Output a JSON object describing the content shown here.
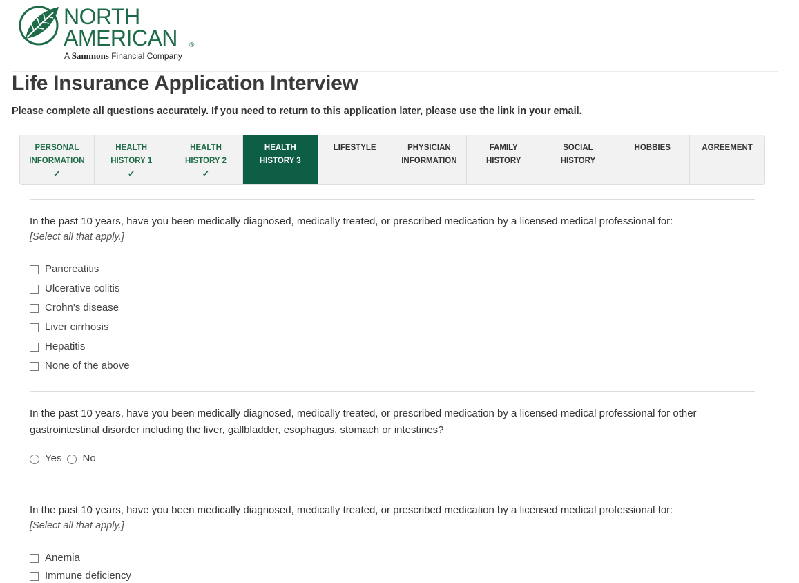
{
  "brand": {
    "name_line1": "NORTH",
    "name_line2": "AMERICAN",
    "registered": "®",
    "tagline_prefix": "A",
    "tagline_brand": "Sammons",
    "tagline_suffix": "Financial Company",
    "color": "#1e6b47"
  },
  "page": {
    "title": "Life Insurance Application Interview",
    "subtitle": "Please complete all questions accurately. If you need to return to this application later, please use the link in your email."
  },
  "tabs": [
    {
      "label": "PERSONAL\nINFORMATION",
      "status": "done",
      "check": "✓"
    },
    {
      "label": "HEALTH\nHISTORY 1",
      "status": "done",
      "check": "✓"
    },
    {
      "label": "HEALTH\nHISTORY 2",
      "status": "done",
      "check": "✓"
    },
    {
      "label": "HEALTH\nHISTORY 3",
      "status": "active",
      "check": ""
    },
    {
      "label": "LIFESTYLE",
      "status": "pending",
      "check": ""
    },
    {
      "label": "PHYSICIAN\nINFORMATION",
      "status": "pending",
      "check": ""
    },
    {
      "label": "FAMILY\nHISTORY",
      "status": "pending",
      "check": ""
    },
    {
      "label": "SOCIAL\nHISTORY",
      "status": "pending",
      "check": ""
    },
    {
      "label": "HOBBIES",
      "status": "pending",
      "check": ""
    },
    {
      "label": "AGREEMENT",
      "status": "pending",
      "check": ""
    }
  ],
  "colors": {
    "active_tab": "#0e5e45",
    "done_tab_text": "#1e6b47"
  },
  "questions": [
    {
      "text": "In the past 10 years, have you been medically diagnosed, medically treated, or prescribed medication by a licensed medical professional for:",
      "hint": "[Select all that apply.]",
      "options": [
        "Pancreatitis",
        "Ulcerative colitis",
        "Crohn's disease",
        "Liver cirrhosis",
        "Hepatitis",
        "None of the above"
      ]
    },
    {
      "text": "In the past 10 years, have you been medically diagnosed, medically treated, or prescribed medication by a licensed medical professional for other gastrointestinal disorder including the liver, gallbladder, esophagus, stomach or intestines?",
      "options": [
        "Yes",
        "No"
      ]
    },
    {
      "text": "In the past 10 years, have you been medically diagnosed, medically treated, or prescribed medication by a licensed medical professional for:",
      "hint": "[Select all that apply.]",
      "options": [
        "Anemia",
        "Immune deficiency"
      ]
    }
  ]
}
